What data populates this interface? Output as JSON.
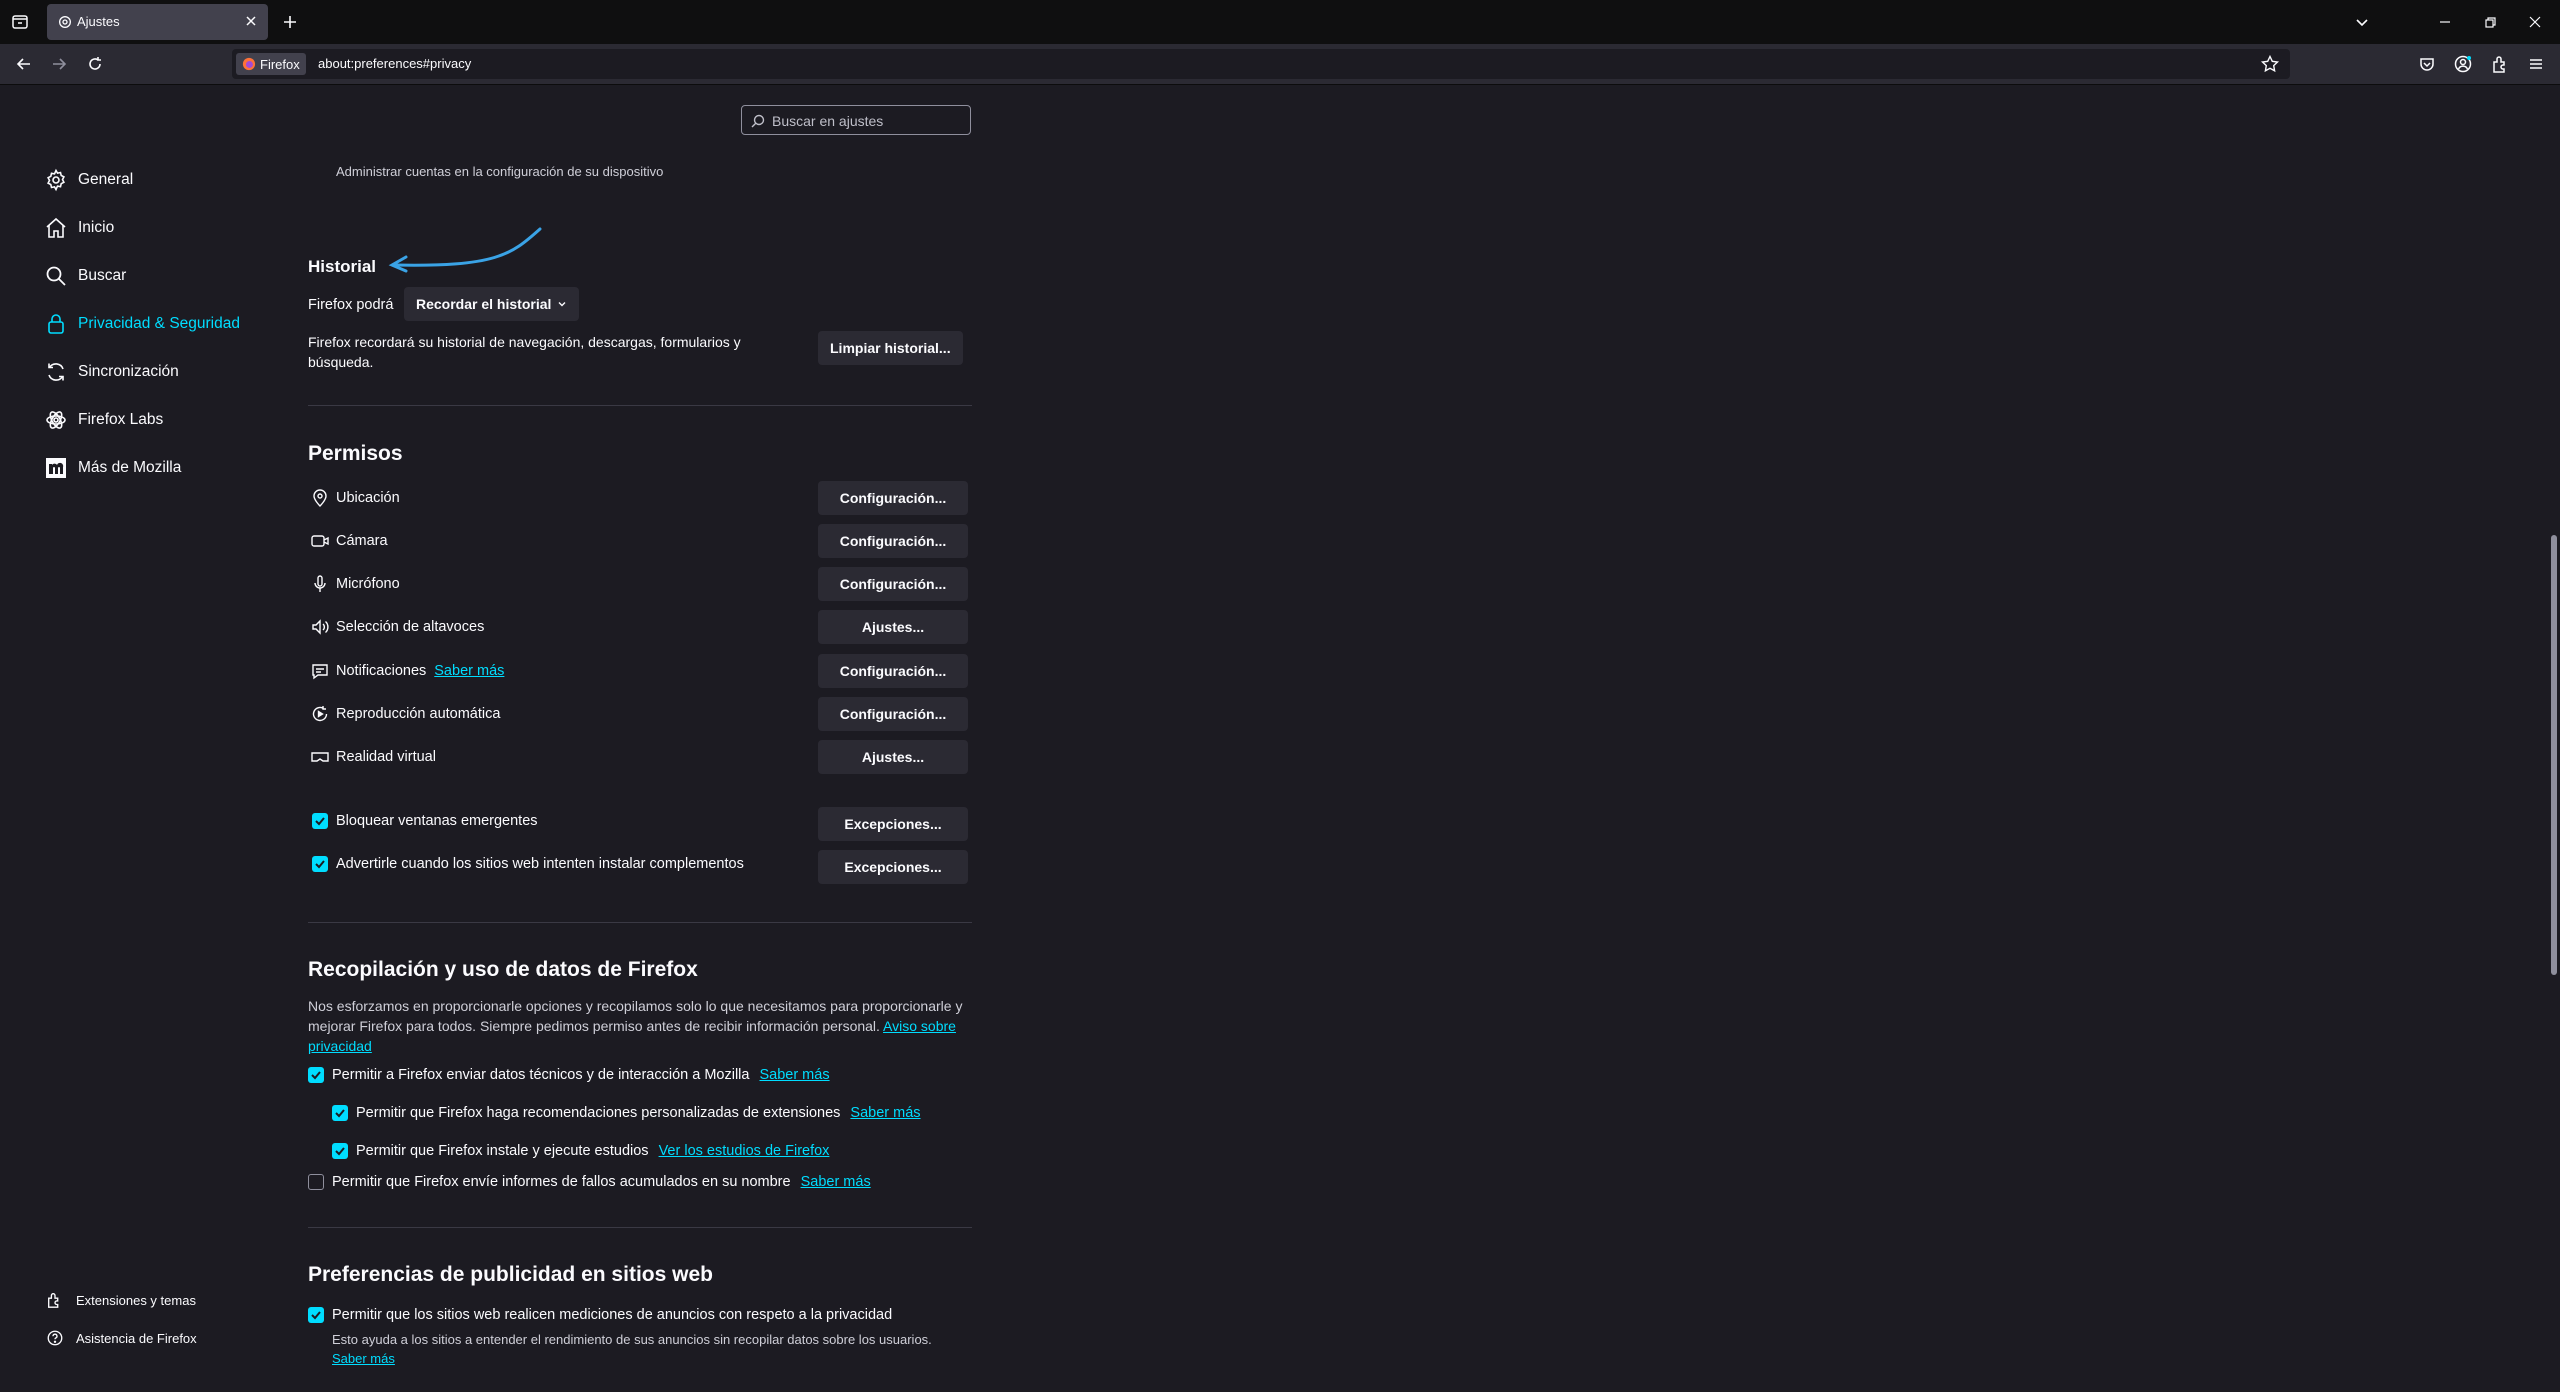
{
  "browser": {
    "tab_title": "Ajustes",
    "identity_label": "Firefox",
    "url": "about:preferences#privacy"
  },
  "search": {
    "placeholder": "Buscar en ajustes"
  },
  "sidebar": {
    "items": [
      {
        "label": "General",
        "icon": "gear-icon"
      },
      {
        "label": "Inicio",
        "icon": "home-icon"
      },
      {
        "label": "Buscar",
        "icon": "search-icon"
      },
      {
        "label": "Privacidad & Seguridad",
        "icon": "lock-icon",
        "selected": true
      },
      {
        "label": "Sincronización",
        "icon": "sync-icon"
      },
      {
        "label": "Firefox Labs",
        "icon": "labs-icon"
      },
      {
        "label": "Más de Mozilla",
        "icon": "mozilla-icon"
      }
    ],
    "footer": [
      {
        "label": "Extensiones y temas",
        "icon": "puzzle-icon"
      },
      {
        "label": "Asistencia de Firefox",
        "icon": "help-icon"
      }
    ]
  },
  "accounts_note": "Administrar cuentas en la configuración de su dispositivo",
  "historial": {
    "title": "Historial",
    "firefox_will_label": "Firefox podrá",
    "history_mode": "Recordar el historial",
    "description": "Firefox recordará su historial de navegación, descargas, formularios y búsqueda.",
    "clear_button": "Limpiar historial..."
  },
  "permisos": {
    "title": "Permisos",
    "items": [
      {
        "label": "Ubicación",
        "button": "Configuración...",
        "icon": "location-icon"
      },
      {
        "label": "Cámara",
        "button": "Configuración...",
        "icon": "camera-icon"
      },
      {
        "label": "Micrófono",
        "button": "Configuración...",
        "icon": "microphone-icon"
      },
      {
        "label": "Selección de altavoces",
        "button": "Ajustes...",
        "icon": "speaker-icon"
      },
      {
        "label": "Notificaciones",
        "link": "Saber más",
        "button": "Configuración...",
        "icon": "notification-icon"
      },
      {
        "label": "Reproducción automática",
        "button": "Configuración...",
        "icon": "autoplay-icon"
      },
      {
        "label": "Realidad virtual",
        "button": "Ajustes...",
        "icon": "vr-icon"
      }
    ],
    "popups_label": "Bloquear ventanas emergentes",
    "popups_button": "Excepciones...",
    "addons_label": "Advertirle cuando los sitios web intenten instalar complementos",
    "addons_button": "Excepciones..."
  },
  "recopilacion": {
    "title": "Recopilación y uso de datos de Firefox",
    "description": "Nos esforzamos en proporcionarle opciones y recopilamos solo lo que necesitamos para proporcionarle y mejorar Firefox para todos. Siempre pedimos permiso antes de recibir información personal.",
    "privacy_link": "Aviso sobre privacidad",
    "options": [
      {
        "label": "Permitir a Firefox enviar datos técnicos y de interacción a Mozilla",
        "link": "Saber más",
        "checked": true
      },
      {
        "label": "Permitir que Firefox haga recomendaciones personalizadas de extensiones",
        "link": "Saber más",
        "checked": true
      },
      {
        "label": "Permitir que Firefox instale y ejecute estudios",
        "link": "Ver los estudios de Firefox",
        "checked": true
      },
      {
        "label": "Permitir que Firefox envíe informes de fallos acumulados en su nombre",
        "link": "Saber más",
        "checked": false
      }
    ]
  },
  "publicidad": {
    "title": "Preferencias de publicidad en sitios web",
    "option_label": "Permitir que los sitios web realicen mediciones de anuncios con respeto a la privacidad",
    "option_checked": true,
    "description": "Esto ayuda a los sitios a entender el rendimiento de sus anuncios sin recopilar datos sobre los usuarios.",
    "link": "Saber más"
  },
  "colors": {
    "accent": "#00ddff",
    "background": "#1c1b22",
    "annotation_arrow": "#3aa3e6"
  }
}
